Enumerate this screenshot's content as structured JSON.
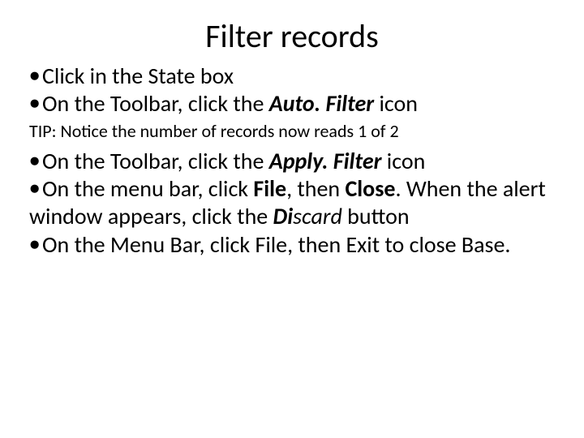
{
  "title": "Filter records",
  "b1": {
    "t1": "Click in the State box"
  },
  "b2": {
    "t1": "On the Toolbar, click the ",
    "em": "Auto. Filter",
    "t2": " icon"
  },
  "tip": "TIP: Notice the number of records now reads 1 of 2",
  "b3": {
    "t1": "On the Toolbar, click the ",
    "em": "Apply. Filter",
    "t2": " icon"
  },
  "b4": {
    "t1": "On the menu bar, click ",
    "em1": "File",
    "t2": ", then ",
    "em2": "Close",
    "t3": ". When the alert window appears, click the ",
    "em3a": "Di",
    "em3b": "scard",
    "t4": " button"
  },
  "b5": {
    "t1": "On the Menu Bar, click File, then Exit to close Base."
  },
  "dot": "●"
}
